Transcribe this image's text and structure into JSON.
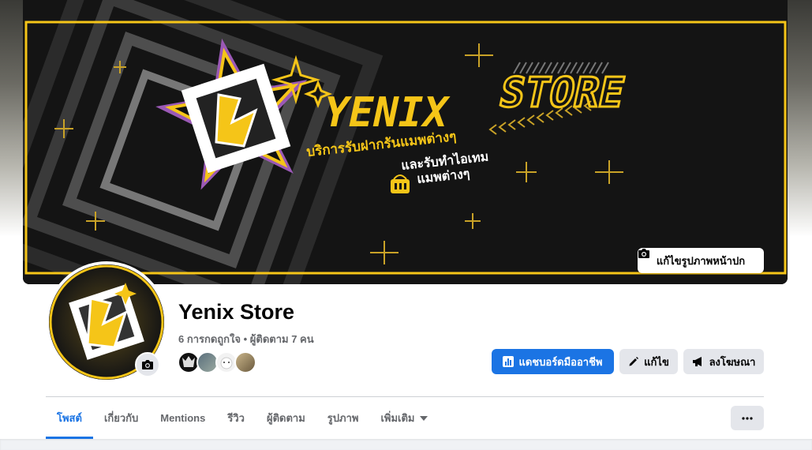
{
  "cover": {
    "title_word1": "YENIX",
    "title_word2": "STORE",
    "line1": "บริการรับฝากรันแมพต่างๆ",
    "line2": "และรับทำไอเทม",
    "line3": "แมพต่างๆ",
    "edit_label": "แก้ไขรูปภาพหน้าปก",
    "accent_color": "#f5c518"
  },
  "profile": {
    "name": "Yenix Store",
    "stats": "6 การกดถูกใจ • ผู้ติดตาม 7 คน"
  },
  "actions": {
    "dashboard_label": "แดชบอร์ดมืออาชีพ",
    "edit_label": "แก้ไข",
    "advertise_label": "ลงโฆษณา"
  },
  "tabs": [
    {
      "label": "โพสต์"
    },
    {
      "label": "เกี่ยวกับ"
    },
    {
      "label": "Mentions"
    },
    {
      "label": "รีวิว"
    },
    {
      "label": "ผู้ติดตาม"
    },
    {
      "label": "รูปภาพ"
    },
    {
      "label": "เพิ่มเติม"
    }
  ],
  "colors": {
    "primary": "#1b74e4",
    "secondary_bg": "#e4e6eb"
  }
}
